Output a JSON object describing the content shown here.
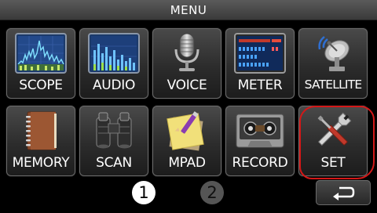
{
  "header": {
    "title": "MENU"
  },
  "tiles": [
    {
      "label": "SCOPE",
      "icon": "scope-icon"
    },
    {
      "label": "AUDIO",
      "icon": "audio-icon"
    },
    {
      "label": "VOICE",
      "icon": "microphone-icon"
    },
    {
      "label": "METER",
      "icon": "meter-icon"
    },
    {
      "label": "SATELLITE",
      "icon": "satellite-dish-icon"
    },
    {
      "label": "MEMORY",
      "icon": "memory-book-icon"
    },
    {
      "label": "SCAN",
      "icon": "binoculars-icon"
    },
    {
      "label": "MPAD",
      "icon": "notepad-icon"
    },
    {
      "label": "RECORD",
      "icon": "cassette-icon"
    },
    {
      "label": "SET",
      "icon": "tools-icon"
    }
  ],
  "pages": {
    "current": "1",
    "next": "2"
  },
  "back": {
    "icon": "return-arrow-icon"
  },
  "colors": {
    "highlight": "#d41818",
    "background": "#000000"
  }
}
